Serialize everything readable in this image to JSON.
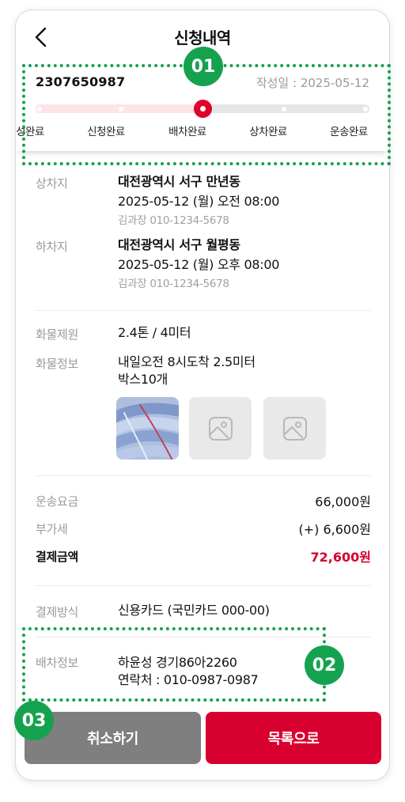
{
  "header": {
    "title": "신청내역",
    "back_icon": "chevron-left-icon"
  },
  "order": {
    "number": "2307650987",
    "written_date": "작성일 : 2025-05-12",
    "steps": [
      "작성완료",
      "신청완료",
      "배차완료",
      "상차완료",
      "운송완료"
    ],
    "current_step": 2,
    "colors": {
      "current": "#e0002a",
      "done_track": "#fde4e7",
      "track": "#e6e6e6"
    }
  },
  "loading": {
    "label": "상차지",
    "address": "대전광역시 서구 만년동",
    "datetime": "2025-05-12 (월)  오전 08:00",
    "contact": "김과장 010-1234-5678"
  },
  "unloading": {
    "label": "하차지",
    "address": "대전광역시 서구 월평동",
    "datetime": "2025-05-12 (월)  오후 08:00",
    "contact": "김과장 010-1234-5678"
  },
  "cargo": {
    "spec_label": "화물제원",
    "spec": "2.4톤 / 4미터",
    "info_label": "화물정보",
    "info_line1": "내일오전 8시도착 2.5미터",
    "info_line2": "박스10개",
    "photos": [
      "photo",
      "image-placeholder-icon",
      "image-placeholder-icon"
    ]
  },
  "payment": {
    "fee_label": "운송요금",
    "fee": "66,000원",
    "vat_label": "부가세",
    "vat": "(+) 6,600원",
    "total_label": "결제금액",
    "total": "72,600원",
    "method_label": "결제방식",
    "method": "신용카드 (국민카드 000-00)"
  },
  "dispatch": {
    "label": "배차정보",
    "driver": "하윤성 경기86아2260",
    "phone": "연락처 : 010-0987-0987"
  },
  "buttons": {
    "cancel": "취소하기",
    "list": "목록으로"
  },
  "annotations": [
    "01",
    "02",
    "03"
  ],
  "colors": {
    "annotation": "#12a150",
    "primary": "#d8002e",
    "secondary": "#7f7f7f"
  }
}
